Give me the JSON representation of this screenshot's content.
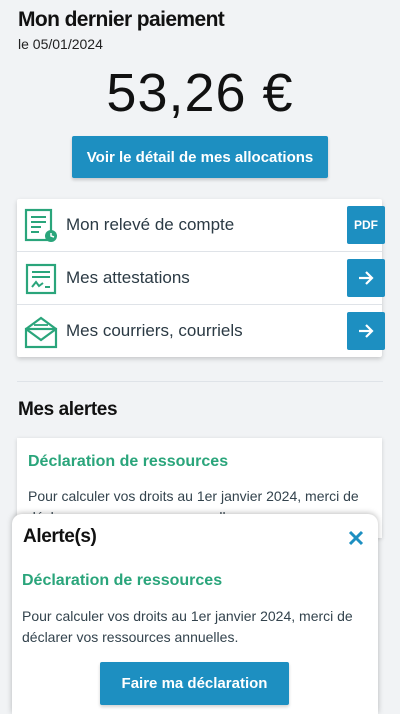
{
  "payment": {
    "title": "Mon dernier paiement",
    "date": "le 05/01/2024",
    "amount": "53,26 €",
    "detail_button": "Voir le détail de mes allocations"
  },
  "documents": {
    "items": [
      {
        "label": "Mon relevé de compte",
        "action": "PDF",
        "icon": "account-statement-icon"
      },
      {
        "label": "Mes attestations",
        "action": "→",
        "icon": "certificate-icon"
      },
      {
        "label": "Mes courriers, courriels",
        "action": "→",
        "icon": "mail-icon"
      }
    ]
  },
  "alerts": {
    "heading": "Mes alertes",
    "card": {
      "title": "Déclaration de ressources",
      "text": "Pour calculer vos droits au 1er janvier 2024, merci de déclarer vos ressources annuelles."
    }
  },
  "sheet": {
    "title": "Alerte(s)",
    "close": "×",
    "subtitle": "Déclaration de ressources",
    "text": "Pour calculer vos droits au 1er janvier 2024, merci de déclarer vos ressources annuelles.",
    "button": "Faire ma déclaration"
  },
  "colors": {
    "primary": "#1d8fc1",
    "accent_green": "#2aa57b",
    "background": "#f1f3f5"
  }
}
